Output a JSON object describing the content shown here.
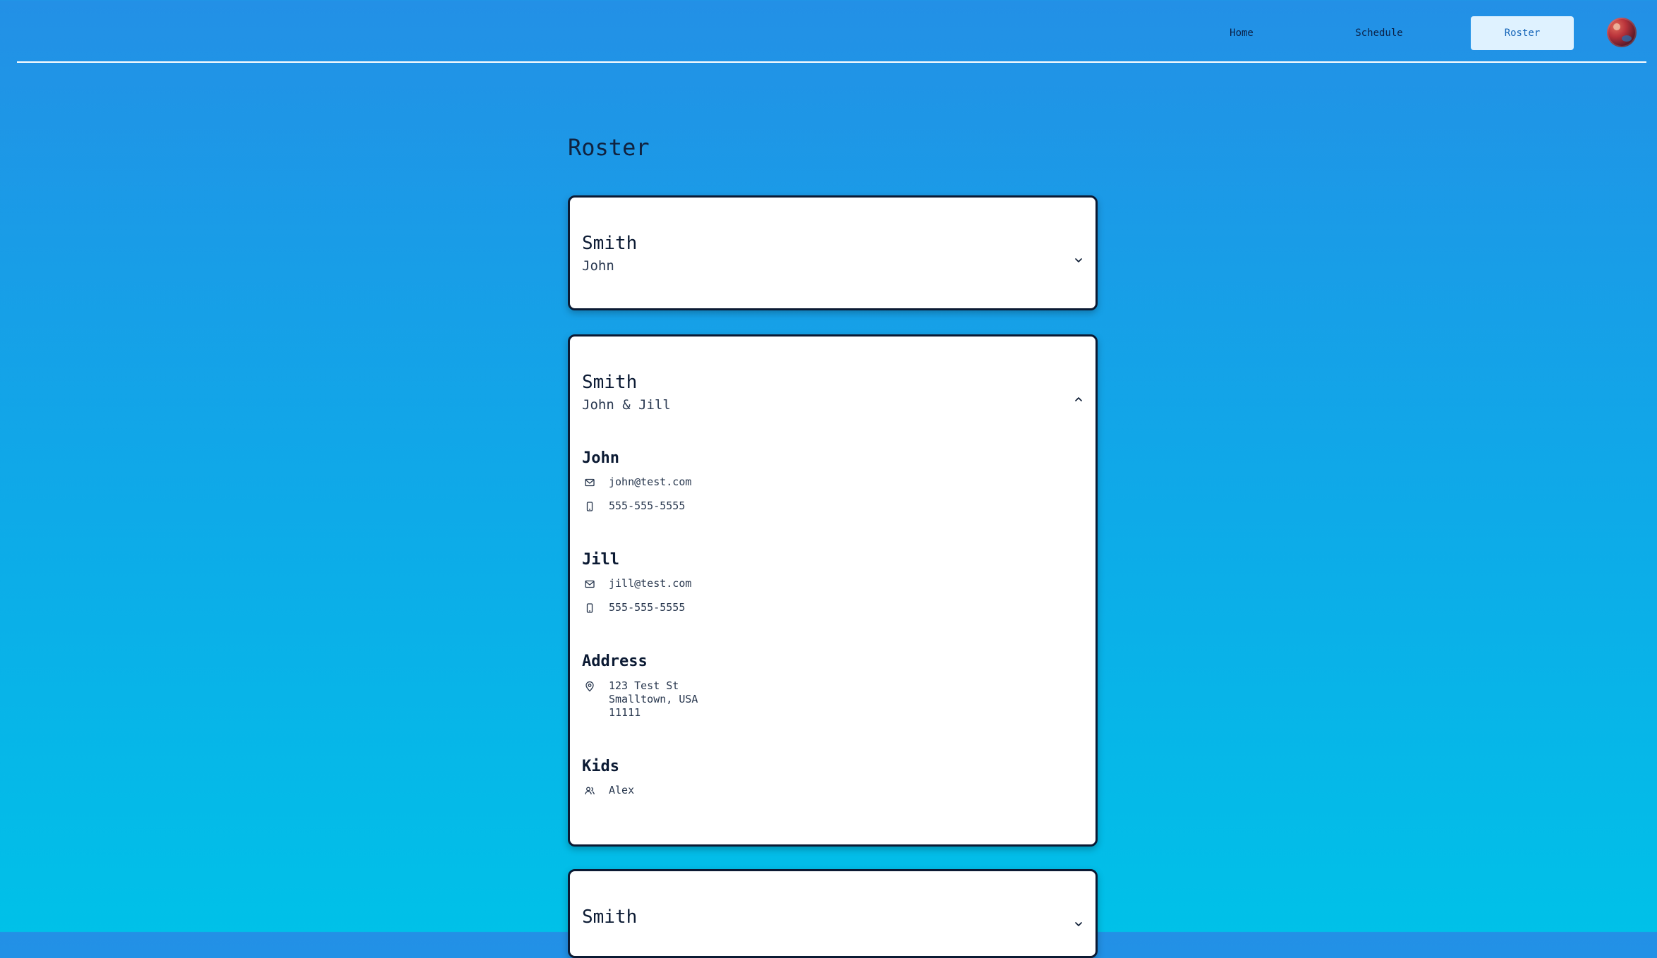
{
  "nav": {
    "items": [
      {
        "label": "Home"
      },
      {
        "label": "Schedule"
      },
      {
        "label": "Roster"
      }
    ],
    "active": "Roster"
  },
  "page": {
    "title": "Roster"
  },
  "families": [
    {
      "surname": "Smith",
      "members": "John",
      "expanded": false
    },
    {
      "surname": "Smith",
      "members": "John & Jill",
      "expanded": true,
      "people": [
        {
          "name": "John",
          "email": "john@test.com",
          "phone": "555-555-5555"
        },
        {
          "name": "Jill",
          "email": "jill@test.com",
          "phone": "555-555-5555"
        }
      ],
      "address_title": "Address",
      "address": [
        "123 Test St",
        "Smalltown, USA",
        "11111"
      ],
      "kids_title": "Kids",
      "kids": [
        "Alex"
      ]
    },
    {
      "surname": "Smith",
      "expanded": false
    }
  ],
  "icons": {
    "email": "mail-icon",
    "phone": "phone-icon",
    "address": "location-pin-icon",
    "kids": "people-icon",
    "collapsed": "chevron-down-icon",
    "expanded": "chevron-up-icon"
  },
  "colors": {
    "accent": "#1565b8",
    "active_tab_bg": "#dff2ff",
    "card_border": "#0b1a33",
    "bg_top": "#2390e6",
    "bg_bottom": "#00c1e8"
  }
}
